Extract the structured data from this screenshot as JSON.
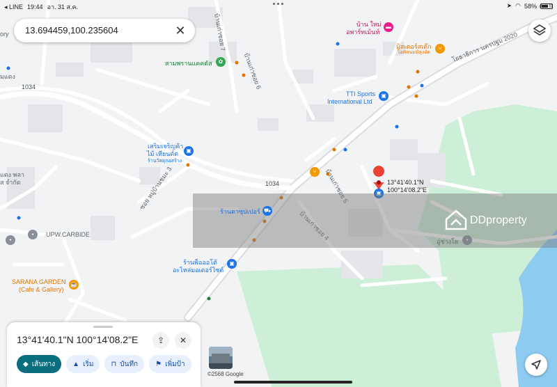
{
  "status_bar": {
    "back_app": "◂ LINE",
    "time": "19:44",
    "date": "อา. 31 ส.ค.",
    "battery": "58%"
  },
  "search": {
    "value": "13.694459,100.235604",
    "clear_icon": "close-icon"
  },
  "map_labels": {
    "road_1034_a": "1034",
    "road_1034_b": "1034",
    "soi_ban_kao_7": "บ้านเก่าซอย 7",
    "soi_ban_kao_6": "บ้านเก่าซอย 6",
    "soi_ban_kao_5": "บ้านเก่าซอย 5",
    "soi_ban_kao_4": "บ้านเก่าซอย 4",
    "soi_mu_ban_3": "ซอย หมู่บ้านชมะ 3",
    "road_phetkasem": "โยธาธิการ นครปฐม 2020",
    "sam_phran_cactus": "สามพรานแคคตัส",
    "ban_mai_apartment_1": "บ้าน ใหม่",
    "ban_mai_apartment_2": "อพาร์ทเม้นท์",
    "mister_steak_1": "มิสเตอร์สเต๊ก",
    "mister_steak_2": "ไอศิลนมมิลุงอ๋ด",
    "tti_sports_1": "TTI Sports",
    "tti_sports_2": "International Ltd",
    "hardware_1": "เสริมเจริญค้า",
    "hardware_2": "ไม้ เหียนต์ด",
    "hardware_3": "ร้านวัสดุกอสร้าง",
    "supermarket": "ร้านตาซุปเปอร์",
    "upw_carbide": "UPW.CARBIDE",
    "sarana_1": "SARANA GARDEN",
    "sarana_2": "(Cafe & Gallery)",
    "auto_parts_1": "ร้านพ็อออโต้",
    "auto_parts_2": "อะไหล่มอเตอร์ไซด์",
    "mechanic": "อู่ช่างโย",
    "left_edge_1": "แตง พลา",
    "left_edge_2": "ส จำกัด",
    "left_edge_3": "มแดง",
    "top_right_edge": "ตำลิ B"
  },
  "pin": {
    "lat": "13°41'40.1\"N",
    "lng": "100°14'08.2\"E"
  },
  "watermark": {
    "brand": "DDproperty"
  },
  "sheet": {
    "title": "13°41'40.1\"N 100°14'08.2\"E",
    "actions": [
      {
        "label": "เส้นทาง",
        "icon": "directions-icon"
      },
      {
        "label": "เริ่ม",
        "icon": "navigation-arrow-icon"
      },
      {
        "label": "บันทึก",
        "icon": "bookmark-icon"
      },
      {
        "label": "เพิ่มป้า",
        "icon": "flag-icon"
      }
    ]
  },
  "footer": {
    "copyright": "©2568 Google"
  },
  "colors": {
    "map_bg": "#f1f3f4",
    "road": "#ffffff",
    "major_road": "#dadce0",
    "park": "#cdeed7",
    "water": "#8ecbf0",
    "building": "#e3e5e8",
    "pin_red": "#ea4335",
    "primary_teal": "#0b6e7f"
  }
}
